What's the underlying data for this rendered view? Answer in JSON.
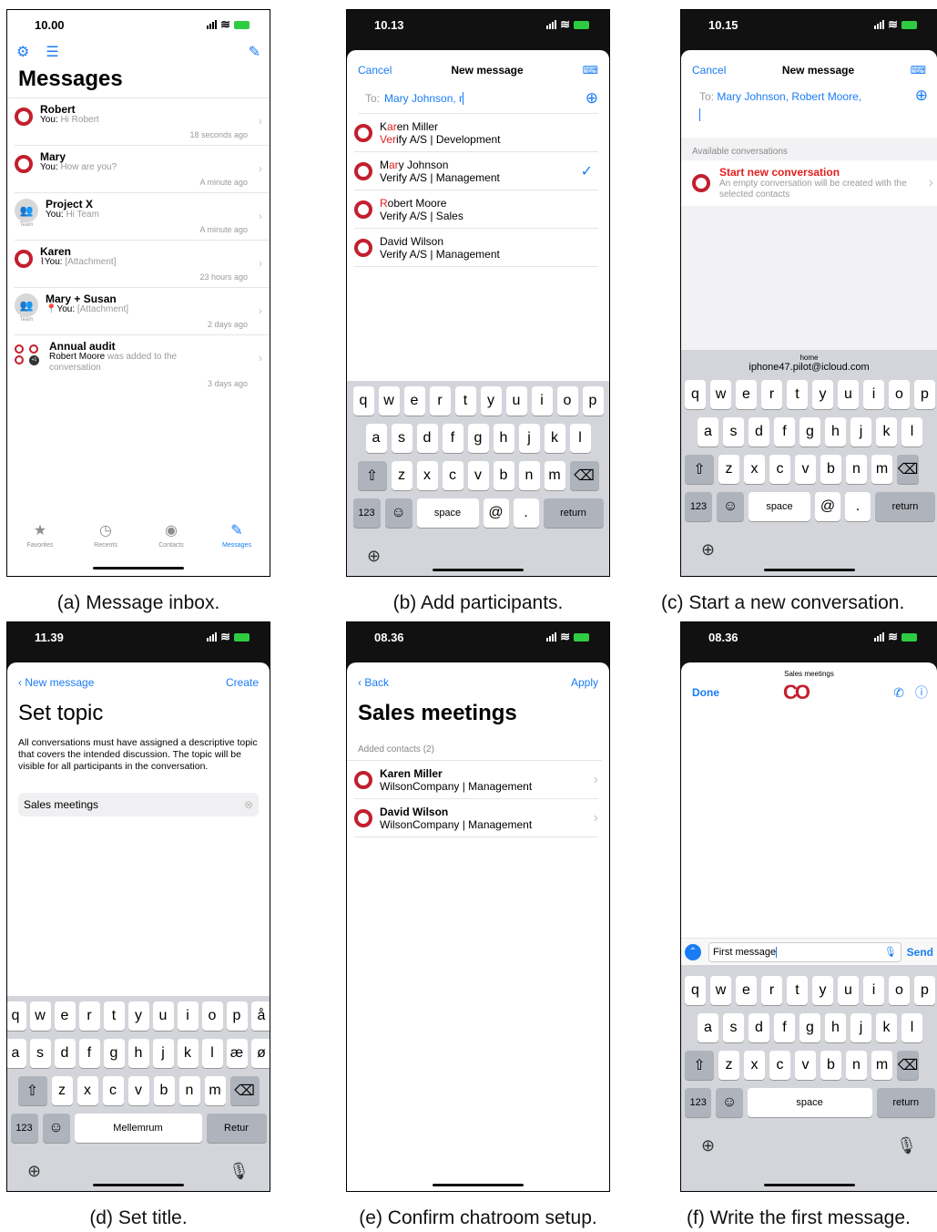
{
  "captions": {
    "a": "(a) Message inbox.",
    "b": "(b) Add participants.",
    "c": "(c) Start a new conversation.",
    "d": "(d) Set title.",
    "e": "(e) Confirm chatroom setup.",
    "f": "(f) Write the first message."
  },
  "a": {
    "time": "10.00",
    "title": "Messages",
    "messages": [
      {
        "name": "Robert",
        "prefix": "You:",
        "preview": "Hi Robert",
        "time": "18 seconds ago",
        "avatar": "ring"
      },
      {
        "name": "Mary",
        "prefix": "You:",
        "preview": "How are you?",
        "time": "A minute ago",
        "avatar": "ring"
      },
      {
        "name": "Project X",
        "prefix": "You:",
        "preview": "Hi Team",
        "time": "A minute ago",
        "avatar": "team",
        "avatar_label": "Team"
      },
      {
        "name": "Karen",
        "prefix": "You:",
        "preview": "[Attachment]",
        "time": "23 hours ago",
        "avatar": "ring",
        "icon": "paperclip-icon"
      },
      {
        "name": "Mary + Susan",
        "prefix": "You:",
        "preview": "[Attachment]",
        "time": "2 days ago",
        "avatar": "team",
        "avatar_label": "Team",
        "icon": "pin-icon"
      },
      {
        "name": "Annual audit",
        "prefix": "Robert Moore",
        "preview": "was added to the conversation",
        "time": "3 days ago",
        "avatar": "group",
        "badge": "+1"
      }
    ],
    "tabs": [
      "Favorites",
      "Recents",
      "Contacts",
      "Messages"
    ]
  },
  "b": {
    "time": "10.13",
    "cancel": "Cancel",
    "title": "New message",
    "to_label": "To:",
    "to_value": "Mary Johnson, r",
    "contacts": [
      {
        "first": "K",
        "hl": "ar",
        "rest": "en Miller",
        "org_hl": "Ver",
        "org_hl_pre": "",
        "org": "ify A/S | Development",
        "checked": false
      },
      {
        "first": "M",
        "hl": "ar",
        "rest": "y Johnson",
        "org": "Verify A/S | Management",
        "checked": true
      },
      {
        "first": "",
        "hl": "R",
        "rest": "obert Moore",
        "org": "Verify A/S | Sales",
        "checked": false
      },
      {
        "first": "David Wilson",
        "hl": "",
        "rest": "",
        "org": "Verify A/S | Management",
        "checked": false
      }
    ],
    "check": "✓"
  },
  "c": {
    "time": "10.15",
    "cancel": "Cancel",
    "title": "New message",
    "to_label": "To:",
    "to_value": "Mary Johnson, Robert Moore,",
    "section": "Available conversations",
    "start_title": "Start new conversation",
    "start_desc": "An empty conversation will be created with the selected contacts",
    "suggest_label": "home",
    "suggest_email": "iphone47.pilot@icloud.com"
  },
  "d": {
    "time": "11.39",
    "back": "New message",
    "create": "Create",
    "title": "Set topic",
    "desc": "All conversations must have assigned a descriptive topic that covers the intended discussion. The topic will be visible for all participants in the conversation.",
    "topic": "Sales meetings",
    "space": "Mellemrum",
    "return": "Retur"
  },
  "e": {
    "time": "08.36",
    "back": "Back",
    "apply": "Apply",
    "title": "Sales meetings",
    "section": "Added contacts (2)",
    "contacts": [
      {
        "name": "Karen Miller",
        "org": "WilsonCompany | Management"
      },
      {
        "name": "David Wilson",
        "org": "WilsonCompany | Management"
      }
    ]
  },
  "f": {
    "time": "08.36",
    "header": "Sales meetings",
    "done": "Done",
    "logo": "CO",
    "input": "First message",
    "send": "Send",
    "space": "space",
    "return": "return"
  },
  "kb": {
    "row1": [
      "q",
      "w",
      "e",
      "r",
      "t",
      "y",
      "u",
      "i",
      "o",
      "p"
    ],
    "row2": [
      "a",
      "s",
      "d",
      "f",
      "g",
      "h",
      "j",
      "k",
      "l"
    ],
    "row3": [
      "z",
      "x",
      "c",
      "v",
      "b",
      "n",
      "m"
    ],
    "num": "123",
    "space": "space",
    "at": "@",
    "dot": ".",
    "ret": "return"
  },
  "kb_da": {
    "row1": [
      "q",
      "w",
      "e",
      "r",
      "t",
      "y",
      "u",
      "i",
      "o",
      "p",
      "å"
    ],
    "row2": [
      "a",
      "s",
      "d",
      "f",
      "g",
      "h",
      "j",
      "k",
      "l",
      "æ",
      "ø"
    ],
    "row3": [
      "z",
      "x",
      "c",
      "v",
      "b",
      "n",
      "m"
    ]
  }
}
